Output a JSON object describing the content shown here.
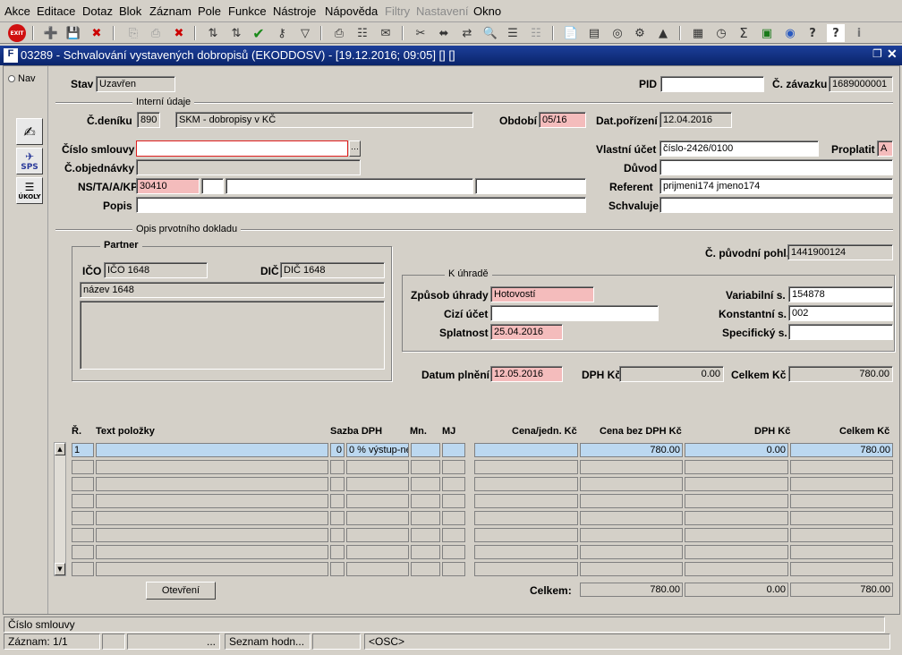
{
  "menu": [
    "Akce",
    "Editace",
    "Dotaz",
    "Blok",
    "Záznam",
    "Pole",
    "Funkce",
    "Nástroje",
    "Nápověda",
    "Filtry",
    "Nastavení",
    "Okno"
  ],
  "window_title": "03289 - Schvalování vystavených dobropisů (EKODDOSV) - [19.12.2016; 09:05] [] []",
  "nav_label": "Nav",
  "side_icons": {
    "sps": "SPS",
    "ukoly": "ÚKOLY"
  },
  "header": {
    "stav_label": "Stav",
    "stav": "Uzavřen",
    "pid_label": "PID",
    "pid": "",
    "zavazek_label": "Č. závazku",
    "zavazek": "1689000001"
  },
  "interni": {
    "title": "Interní údaje",
    "denik_label": "Č.deníku",
    "denik": "890",
    "denik_name": "SKM - dobropisy v KČ",
    "obdobi_label": "Období",
    "obdobi": "05/16",
    "datpor_label": "Dat.pořízení",
    "datpor": "12.04.2016",
    "smlouva_label": "Číslo smlouvy",
    "smlouva": "",
    "objed_label": "Č.objednávky",
    "objed": "",
    "ns_label": "NS/TA/A/KP",
    "ns": "30410",
    "popis_label": "Popis",
    "popis": "",
    "ucet_label": "Vlastní účet",
    "ucet": "číslo-2426/0100",
    "proplatit_label": "Proplatit",
    "proplatit": "A",
    "duvod_label": "Důvod",
    "duvod": "",
    "referent_label": "Referent",
    "referent": "prijmeni174 jmeno174",
    "schvaluje_label": "Schvaluje",
    "schvaluje": ""
  },
  "opis": {
    "title": "Opis prvotního dokladu",
    "partner_title": "Partner",
    "ico_label": "IČO",
    "ico": "IČO 1648",
    "dic_label": "DIČ",
    "dic": "DIČ 1648",
    "nazev": "název 1648",
    "puvodni_label": "Č. původní pohl.",
    "puvodni": "1441900124",
    "uhrada_title": "K úhradě",
    "zpusob_label": "Způsob úhrady",
    "zpusob": "Hotovostí",
    "cizi_label": "Cizí účet",
    "cizi": "",
    "splat_label": "Splatnost",
    "splat": "25.04.2016",
    "var_label": "Variabilní s.",
    "var": "154878",
    "konst_label": "Konstantní s.",
    "konst": "002",
    "spec_label": "Specifický s.",
    "spec": "",
    "plneni_label": "Datum plnění",
    "plneni": "12.05.2016",
    "dph_label": "DPH Kč",
    "dph": "0.00",
    "celkem_label": "Celkem Kč",
    "celkem": "780.00"
  },
  "items": {
    "headers": [
      "Ř.",
      "Text položky",
      "Sazba DPH",
      "Mn.",
      "MJ",
      "Cena/jedn. Kč",
      "Cena bez DPH Kč",
      "DPH Kč",
      "Celkem Kč"
    ],
    "rows": [
      {
        "r": "1",
        "text": "",
        "sazba": "0",
        "sazba_text": "0 % výstup-ne",
        "mn": "",
        "mj": "",
        "cena": "",
        "bez": "780.00",
        "dph": "0.00",
        "celkem": "780.00"
      }
    ],
    "open_button": "Otevření",
    "sum_label": "Celkem:",
    "sum_bez": "780.00",
    "sum_dph": "0.00",
    "sum_celkem": "780.00"
  },
  "status": {
    "hint": "Číslo smlouvy",
    "zaznam": "Záznam: 1/1",
    "dots": "...",
    "seznam": "Seznam hodn...",
    "osc": "<OSC>"
  }
}
